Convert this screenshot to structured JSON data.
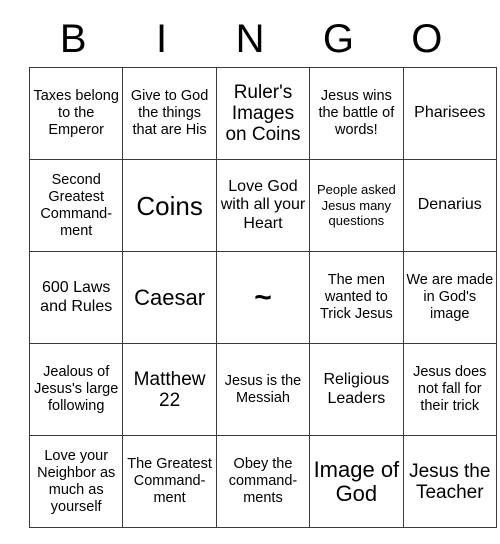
{
  "card": {
    "header_letters": [
      "B",
      "I",
      "N",
      "G",
      "O"
    ],
    "rows": [
      [
        {
          "text": "Taxes belong to the Emperor",
          "size": "sz-sm"
        },
        {
          "text": "Give to God the things that are His",
          "size": "sz-sm"
        },
        {
          "text": "Ruler's Images on Coins",
          "size": "sz-lg"
        },
        {
          "text": "Jesus wins the battle of words!",
          "size": "sz-sm"
        },
        {
          "text": "Pharisees",
          "size": "sz-md"
        }
      ],
      [
        {
          "text": "Second Greatest Command-ment",
          "size": "sz-sm"
        },
        {
          "text": "Coins",
          "size": "sz-xxl"
        },
        {
          "text": "Love God with all your Heart",
          "size": "sz-md"
        },
        {
          "text": "People asked Jesus many questions",
          "size": "sz-xs"
        },
        {
          "text": "Denarius",
          "size": "sz-md"
        }
      ],
      [
        {
          "text": "600 Laws and Rules",
          "size": "sz-md"
        },
        {
          "text": "Caesar",
          "size": "sz-xl"
        },
        {
          "text": "~",
          "size": "free-space"
        },
        {
          "text": "The men wanted to Trick Jesus",
          "size": "sz-sm"
        },
        {
          "text": "We are made in God's image",
          "size": "sz-sm"
        }
      ],
      [
        {
          "text": "Jealous of Jesus's large following",
          "size": "sz-sm"
        },
        {
          "text": "Matthew 22",
          "size": "sz-lg"
        },
        {
          "text": "Jesus is the Messiah",
          "size": "sz-sm"
        },
        {
          "text": "Religious Leaders",
          "size": "sz-md"
        },
        {
          "text": "Jesus does not fall for their trick",
          "size": "sz-sm"
        }
      ],
      [
        {
          "text": "Love your Neighbor as much as yourself",
          "size": "sz-sm"
        },
        {
          "text": "The Greatest Command-ment",
          "size": "sz-sm"
        },
        {
          "text": "Obey the command-ments",
          "size": "sz-sm"
        },
        {
          "text": "Image of God",
          "size": "sz-xl"
        },
        {
          "text": "Jesus the Teacher",
          "size": "sz-lg"
        }
      ]
    ]
  },
  "colors": {
    "background": "#ffffff",
    "text": "#000000",
    "border": "#3a3a3a"
  }
}
